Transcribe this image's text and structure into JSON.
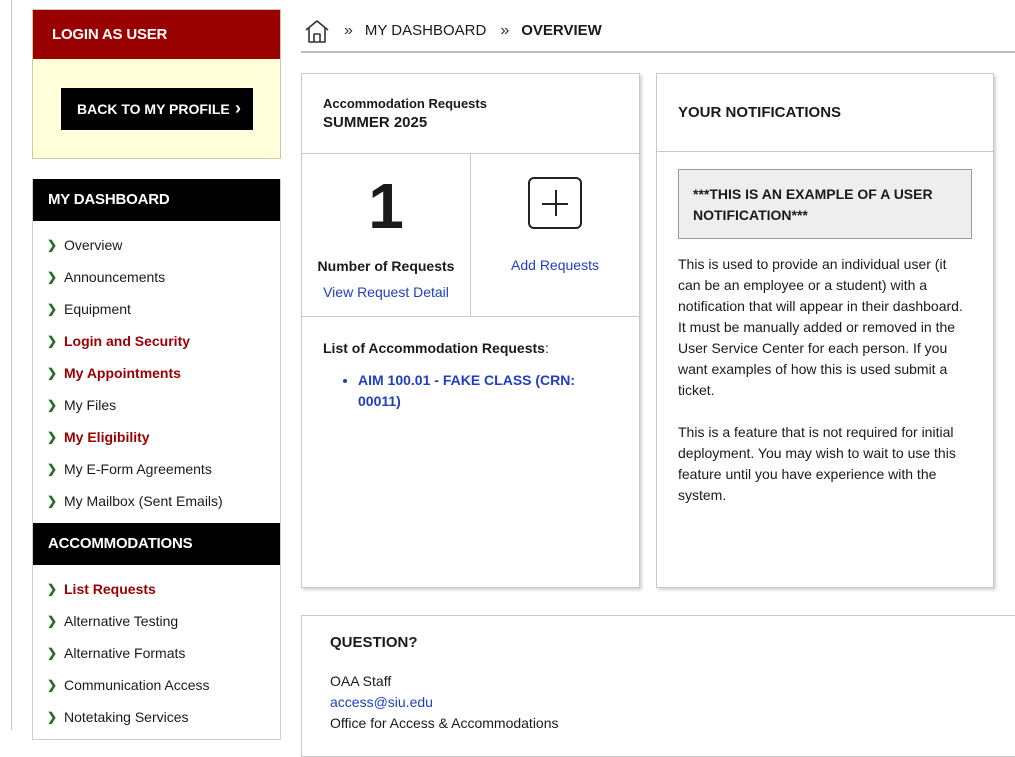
{
  "sidebar": {
    "login_title": "LOGIN AS USER",
    "back_button": "BACK TO MY PROFILE",
    "dashboard_heading": "MY DASHBOARD",
    "dashboard_items": [
      {
        "label": "Overview"
      },
      {
        "label": "Announcements"
      },
      {
        "label": "Equipment"
      },
      {
        "label": "Login and Security"
      },
      {
        "label": "My Appointments"
      },
      {
        "label": "My Files"
      },
      {
        "label": "My Eligibility"
      },
      {
        "label": "My E-Form Agreements"
      },
      {
        "label": "My Mailbox (Sent Emails)"
      }
    ],
    "accommodations_heading": "ACCOMMODATIONS",
    "accommodations_items": [
      {
        "label": "List Requests"
      },
      {
        "label": "Alternative Testing"
      },
      {
        "label": "Alternative Formats"
      },
      {
        "label": "Communication Access"
      },
      {
        "label": "Notetaking Services"
      }
    ]
  },
  "breadcrumb": {
    "level1": "MY DASHBOARD",
    "current": "OVERVIEW"
  },
  "accommodation_card": {
    "subtitle": "Accommodation Requests",
    "term": "SUMMER 2025",
    "count": "1",
    "count_label": "Number of Requests",
    "view_link": "View Request Detail",
    "add_link": "Add Requests",
    "list_title": "List of Accommodation Requests",
    "list_colon": ":",
    "requests": [
      "AIM 100.01 - FAKE CLASS (CRN: 00011)"
    ]
  },
  "notifications": {
    "title": "YOUR NOTIFICATIONS",
    "example": "***THIS IS AN EXAMPLE OF A USER NOTIFICATION***",
    "paragraph1": "This is used to provide an individual user (it can be an employee or a student) with a notification that will appear in their dashboard. It must be manually added or removed in the User Service Center for each person. If you want examples of how this is used submit a ticket.",
    "paragraph2": "This is a feature that is not required for initial deployment. You may wish to wait to use this feature until you have experience with the system."
  },
  "question": {
    "title": "QUESTION?",
    "staff": "OAA Staff",
    "email": "access@siu.edu",
    "office": "Office for Access & Accommodations"
  },
  "colors": {
    "brand_red": "#990000",
    "link_blue": "#1f3fbf",
    "login_bg": "#ffffd9"
  }
}
